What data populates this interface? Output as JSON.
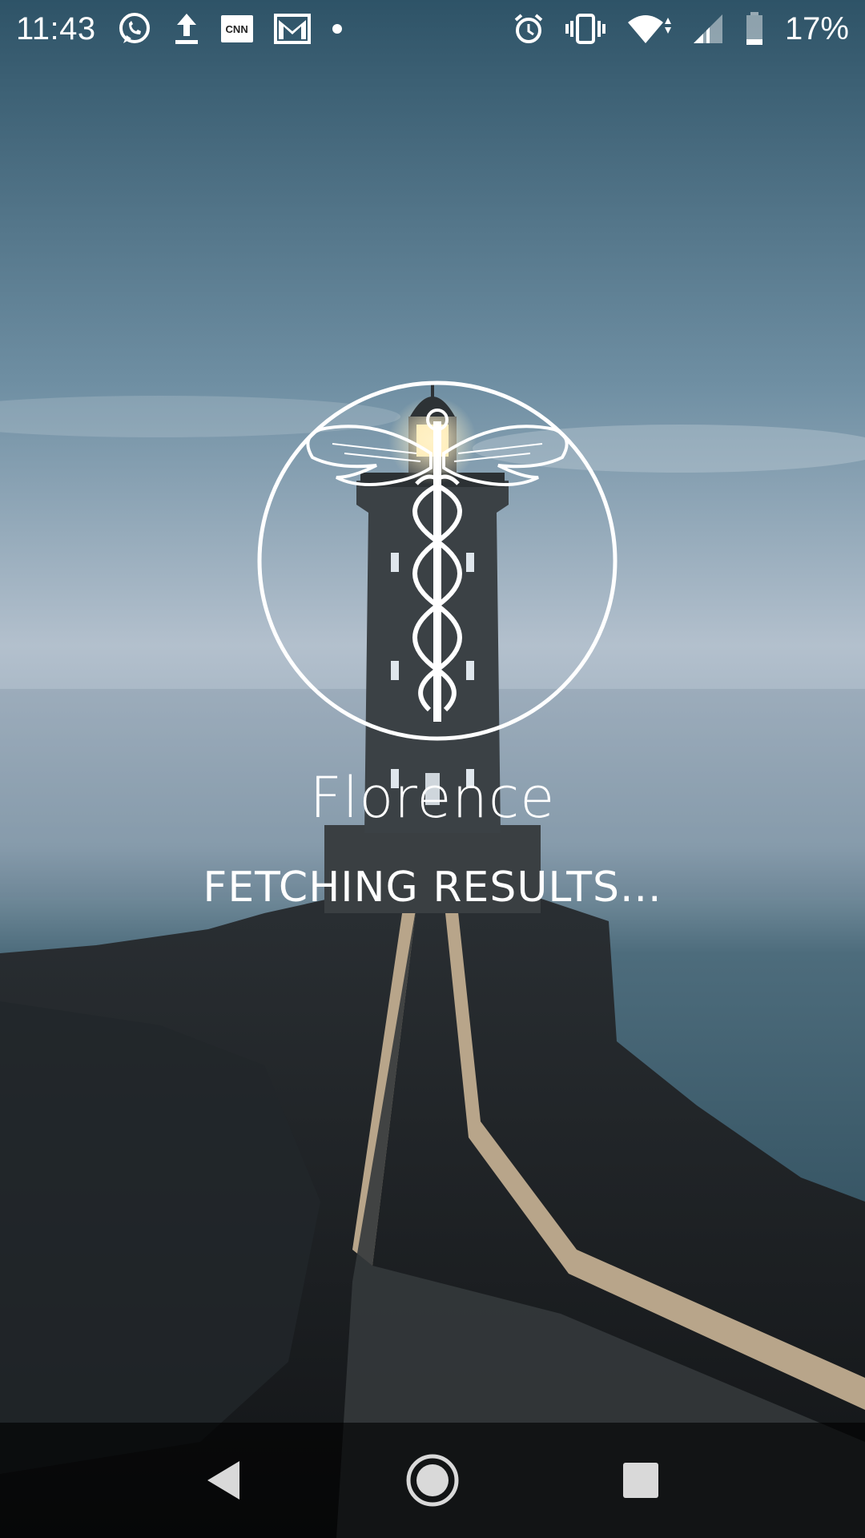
{
  "status_bar": {
    "time": "11:43",
    "battery_percent": "17%",
    "notification_icons": [
      "whatsapp-icon",
      "upload-icon",
      "cnn-icon",
      "gmail-icon",
      "dot-icon"
    ],
    "system_icons": [
      "alarm-icon",
      "vibrate-icon",
      "wifi-icon",
      "signal-icon",
      "battery-icon"
    ],
    "cnn_label": "CNN"
  },
  "splash": {
    "app_name": "Florence",
    "status_text": "FETCHING RESULTS...",
    "logo_icon": "caduceus-icon"
  },
  "nav_bar": {
    "buttons": [
      "back-icon",
      "home-icon",
      "recents-icon"
    ]
  },
  "colors": {
    "sky_top": "#3f6479",
    "sky_mid": "#aebccb",
    "sea": "#1f4556",
    "rock": "#1a1d20",
    "text": "#ffffff"
  }
}
